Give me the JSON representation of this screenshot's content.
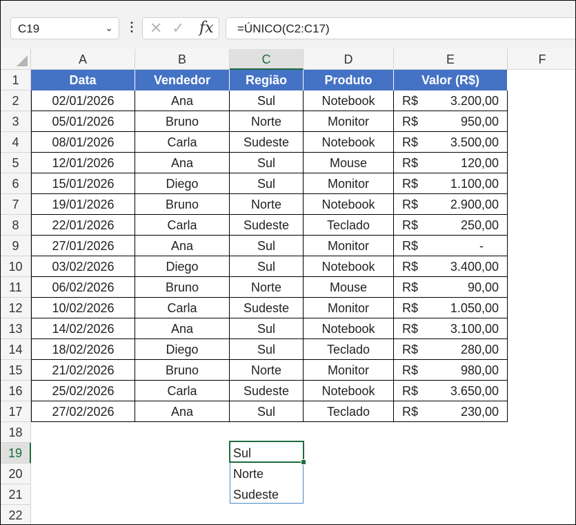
{
  "formula_bar": {
    "name_box": "C19",
    "formula": "=ÚNICO(C2:C17)",
    "cancel_glyph": "✕",
    "enter_glyph": "✓",
    "fx_label": "fx"
  },
  "columns": [
    "A",
    "B",
    "C",
    "D",
    "E",
    "F"
  ],
  "rows": [
    "1",
    "2",
    "3",
    "4",
    "5",
    "6",
    "7",
    "8",
    "9",
    "10",
    "11",
    "12",
    "13",
    "14",
    "15",
    "16",
    "17",
    "18",
    "19",
    "20",
    "21",
    "22"
  ],
  "table": {
    "headers": [
      "Data",
      "Vendedor",
      "Região",
      "Produto",
      "Valor (R$)"
    ],
    "currency": "R$",
    "data": [
      [
        "02/01/2026",
        "Ana",
        "Sul",
        "Notebook",
        "3.200,00"
      ],
      [
        "05/01/2026",
        "Bruno",
        "Norte",
        "Monitor",
        "950,00"
      ],
      [
        "08/01/2026",
        "Carla",
        "Sudeste",
        "Notebook",
        "3.500,00"
      ],
      [
        "12/01/2026",
        "Ana",
        "Sul",
        "Mouse",
        "120,00"
      ],
      [
        "15/01/2026",
        "Diego",
        "Sul",
        "Monitor",
        "1.100,00"
      ],
      [
        "19/01/2026",
        "Bruno",
        "Norte",
        "Notebook",
        "2.900,00"
      ],
      [
        "22/01/2026",
        "Carla",
        "Sudeste",
        "Teclado",
        "250,00"
      ],
      [
        "27/01/2026",
        "Ana",
        "Sul",
        "Monitor",
        "-"
      ],
      [
        "03/02/2026",
        "Diego",
        "Sul",
        "Notebook",
        "3.400,00"
      ],
      [
        "06/02/2026",
        "Bruno",
        "Norte",
        "Mouse",
        "90,00"
      ],
      [
        "10/02/2026",
        "Carla",
        "Sudeste",
        "Monitor",
        "1.050,00"
      ],
      [
        "14/02/2026",
        "Ana",
        "Sul",
        "Notebook",
        "3.100,00"
      ],
      [
        "18/02/2026",
        "Diego",
        "Sul",
        "Teclado",
        "280,00"
      ],
      [
        "21/02/2026",
        "Bruno",
        "Norte",
        "Monitor",
        "980,00"
      ],
      [
        "25/02/2026",
        "Carla",
        "Sudeste",
        "Notebook",
        "3.650,00"
      ],
      [
        "27/02/2026",
        "Ana",
        "Sul",
        "Teclado",
        "230,00"
      ]
    ]
  },
  "spill_result": [
    "Sul",
    "Norte",
    "Sudeste"
  ],
  "colors": {
    "header_fill": "#4472c4",
    "selection": "#1e6b3c",
    "spill_border": "#4a86c5"
  }
}
